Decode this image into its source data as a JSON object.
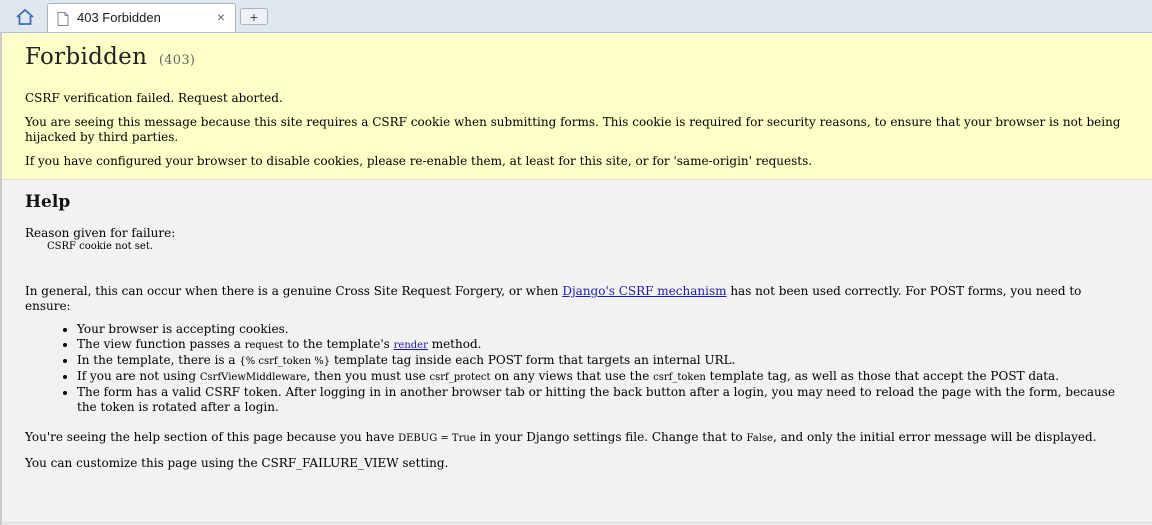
{
  "browser": {
    "tab_title": "403 Forbidden",
    "close_glyph": "×",
    "new_tab_glyph": "+"
  },
  "summary": {
    "heading": "Forbidden",
    "code": "(403)",
    "line1": "CSRF verification failed. Request aborted.",
    "line2": "You are seeing this message because this site requires a CSRF cookie when submitting forms. This cookie is required for security reasons, to ensure that your browser is not being hijacked by third parties.",
    "line3": "If you have configured your browser to disable cookies, please re-enable them, at least for this site, or for 'same-origin' requests."
  },
  "help": {
    "heading": "Help",
    "reason_label": "Reason given for failure:",
    "reason_value": "CSRF cookie not set.",
    "general_before": "In general, this can occur when there is a genuine Cross Site Request Forgery, or when ",
    "general_link": "Django's CSRF mechanism",
    "general_after": " has not been used correctly. For POST forms, you need to ensure:",
    "bullet1": "Your browser is accepting cookies.",
    "bullet2_a": "The view function passes a ",
    "bullet2_code": "request",
    "bullet2_b": " to the template's ",
    "bullet2_link": "render",
    "bullet2_c": " method.",
    "bullet3_a": "In the template, there is a ",
    "bullet3_code": "{% csrf_token %}",
    "bullet3_b": " template tag inside each POST form that targets an internal URL.",
    "bullet4_a": "If you are not using ",
    "bullet4_code1": "CsrfViewMiddleware",
    "bullet4_b": ", then you must use ",
    "bullet4_code2": "csrf_protect",
    "bullet4_c": " on any views that use the ",
    "bullet4_code3": "csrf_token",
    "bullet4_d": " template tag, as well as those that accept the POST data.",
    "bullet5": "The form has a valid CSRF token. After logging in in another browser tab or hitting the back button after a login, you may need to reload the page with the form, because the token is rotated after a login.",
    "debug_a": "You're seeing the help section of this page because you have ",
    "debug_code1": "DEBUG = True",
    "debug_b": " in your Django settings file. Change that to ",
    "debug_code2": "False",
    "debug_c": ", and only the initial error message will be displayed.",
    "customize": "You can customize this page using the CSRF_FAILURE_VIEW setting."
  }
}
